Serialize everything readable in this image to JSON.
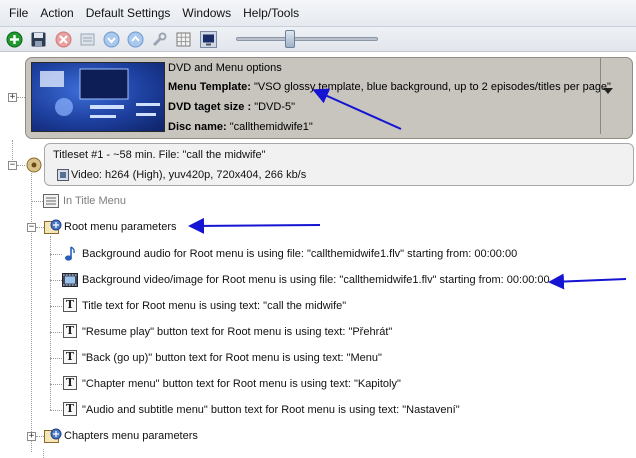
{
  "menu": [
    "File",
    "Action",
    "Default Settings",
    "Windows",
    "Help/Tools"
  ],
  "dvd": {
    "header": "DVD and Menu options",
    "template_label": "Menu Template:",
    "template_value": "\"VSO glossy template, blue background, up to 2 episodes/titles per page\"",
    "size_label": "DVD taget size :",
    "size_value": "\"DVD-5\"",
    "disc_label": "Disc name:",
    "disc_value": "\"callthemidwife1\""
  },
  "titleset": {
    "line1": "Titleset #1 - ~58 min. File: \"call the midwife\"",
    "line2": "Video: h264 (High), yuv420p, 720x404, 266 kb/s"
  },
  "tree": {
    "in_title_menu": "In Title Menu",
    "root_menu": "Root menu parameters",
    "bg_audio": "Background audio for Root menu is using file: \"callthemidwife1.flv\" starting from: 00:00:00",
    "bg_video": "Background video/image for Root menu is using file: \"callthemidwife1.flv\" starting from: 00:00:00",
    "title_text": "Title text for Root menu is using text: \"call the midwife\"",
    "resume_text": "\"Resume play\" button text for Root menu is using text: \"Přehrát\"",
    "back_text": "\"Back (go up)\" button text for Root menu is using text: \"Menu\"",
    "chapter_text": "\"Chapter menu\" button text for Root menu is using text: \"Kapitoly\"",
    "audio_sub_text": "\"Audio and subtitle menu\" button text for Root menu is using text: \"Nastavení\"",
    "chapters_menu": "Chapters menu parameters"
  },
  "slider": {
    "value_fraction": 0.36
  },
  "colors": {
    "annotation_arrow": "#1414d2",
    "dvd_panel": "#c7c5be"
  }
}
